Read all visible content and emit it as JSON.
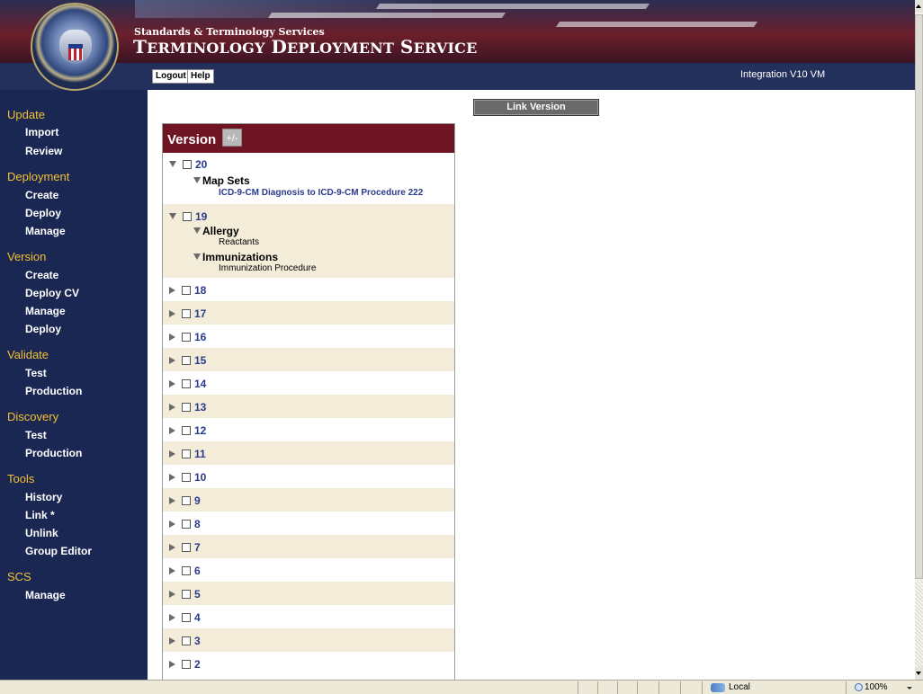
{
  "header": {
    "subtitle": "Standards & Terminology Services",
    "title": "Terminology Deployment Service",
    "logout_label": "Logout",
    "help_label": "Help",
    "environment": "Integration V10 VM"
  },
  "sidebar": {
    "update": {
      "heading": "Update",
      "items": [
        "Import",
        "Review"
      ]
    },
    "deployment": {
      "heading": "Deployment",
      "items": [
        "Create",
        "Deploy",
        "Manage"
      ]
    },
    "version": {
      "heading": "Version",
      "items": [
        "Create",
        "Deploy CV",
        "Manage",
        "Deploy"
      ]
    },
    "validate": {
      "heading": "Validate",
      "items": [
        "Test",
        "Production"
      ]
    },
    "discovery": {
      "heading": "Discovery",
      "items": [
        "Test",
        "Production"
      ]
    },
    "tools": {
      "heading": "Tools",
      "items": [
        "History",
        "Link *",
        "Unlink",
        "Group Editor"
      ]
    },
    "scs": {
      "heading": "SCS",
      "items": [
        "Manage"
      ]
    }
  },
  "tree": {
    "title": "Version",
    "toggle_label": "+/-",
    "expanded": [
      {
        "number": "20",
        "groups": [
          {
            "name": "Map Sets",
            "items": [
              "ICD-9-CM Diagnosis to ICD-9-CM Procedure 222"
            ]
          }
        ]
      },
      {
        "number": "19",
        "groups": [
          {
            "name": "Allergy",
            "items": [
              "Reactants"
            ]
          },
          {
            "name": "Immunizations",
            "items": [
              "Immunization Procedure"
            ]
          }
        ]
      }
    ],
    "collapsed": [
      "18",
      "17",
      "16",
      "15",
      "14",
      "13",
      "12",
      "11",
      "10",
      "9",
      "8",
      "7",
      "6",
      "5",
      "4",
      "3",
      "2"
    ]
  },
  "link_version_label": "Link Version",
  "statusbar": {
    "zone": "Local intranet",
    "zoom": "100%"
  },
  "colors": {
    "sidebar_bg": "#1a2753",
    "nav_heading": "#f2c230",
    "tree_header": "#6e1422",
    "row_alt": "#f2ecd8",
    "link": "#2a3a8c"
  }
}
